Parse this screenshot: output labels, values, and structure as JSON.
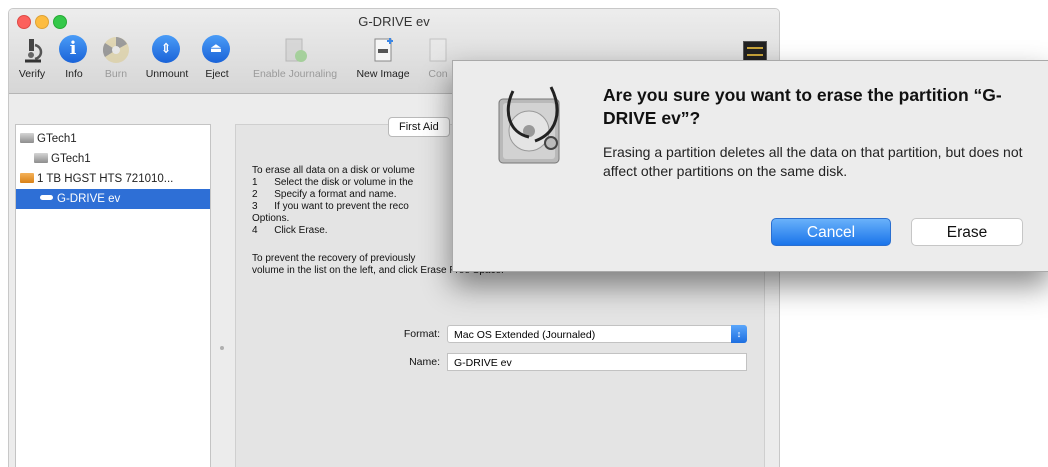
{
  "window": {
    "title": "G-DRIVE ev"
  },
  "toolbar": {
    "items": [
      {
        "label": "Verify",
        "icon": "microscope-icon",
        "enabled": true
      },
      {
        "label": "Info",
        "icon": "info-icon",
        "enabled": true
      },
      {
        "label": "Burn",
        "icon": "burn-icon",
        "enabled": false
      },
      {
        "label": "Unmount",
        "icon": "unmount-icon",
        "enabled": true
      },
      {
        "label": "Eject",
        "icon": "eject-icon",
        "enabled": true
      },
      {
        "label": "Enable Journaling",
        "icon": "journaling-icon",
        "enabled": false
      },
      {
        "label": "New Image",
        "icon": "new-image-icon",
        "enabled": true
      },
      {
        "label": "Con",
        "icon": "convert-icon",
        "enabled": false
      }
    ],
    "log_icon": "log-icon"
  },
  "sidebar": {
    "items": [
      {
        "label": "GTech1",
        "type": "disk",
        "selected": false
      },
      {
        "label": "GTech1",
        "type": "volume-gray",
        "selected": false
      },
      {
        "label": "1 TB HGST HTS 721010...",
        "type": "disk-orange",
        "selected": false
      },
      {
        "label": "G-DRIVE ev",
        "type": "volume",
        "selected": true
      }
    ]
  },
  "panel": {
    "tab_first_aid": "First Aid",
    "instructions": [
      "To erase all data on a disk or volume",
      "1      Select the disk or volume in the",
      "2      Specify a format and name.",
      "3      If you want to prevent the reco",
      "Options.",
      "4      Click Erase."
    ],
    "recovery_line1": "To prevent the recovery of previously",
    "recovery_line2": "volume in the list on the left, and click Erase Free Space.",
    "format_label": "Format:",
    "format_value": "Mac OS Extended (Journaled)",
    "name_label": "Name:",
    "name_value": "G-DRIVE ev"
  },
  "dialog": {
    "title": "Are you sure you want to erase the partition “G-DRIVE ev”?",
    "body": "Erasing a partition deletes all the data on that partition, but does not affect other partitions on the same disk.",
    "cancel_label": "Cancel",
    "erase_label": "Erase",
    "icon": "disk-utility-stethoscope-icon",
    "accent": "#1a74ea"
  }
}
